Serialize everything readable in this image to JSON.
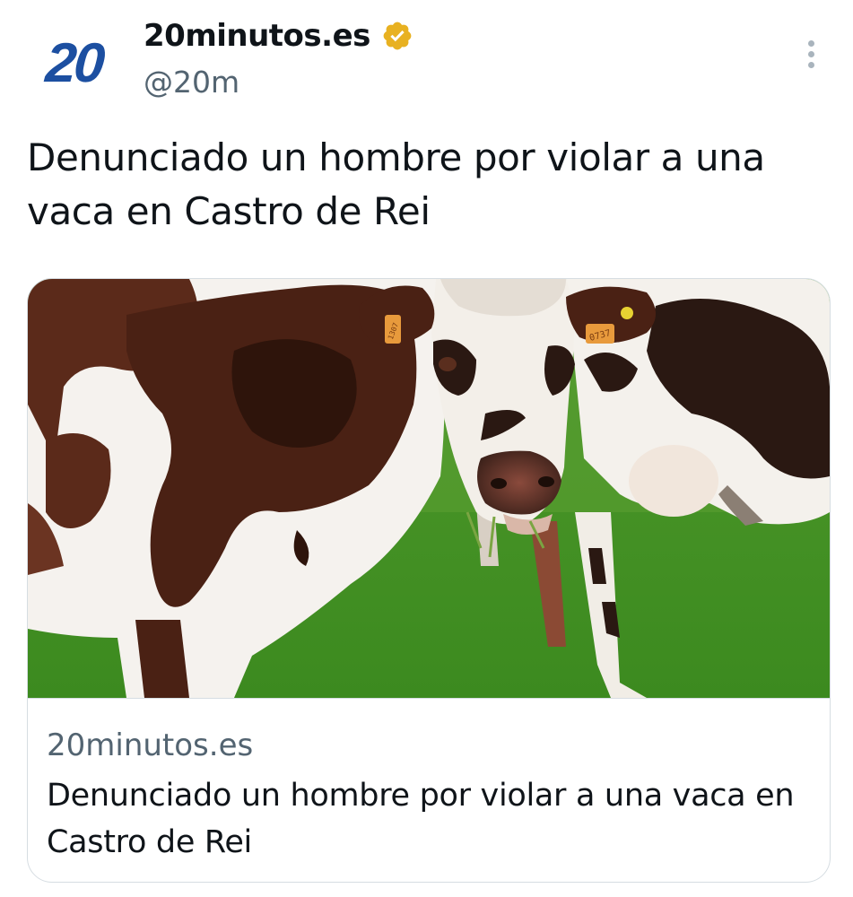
{
  "author": {
    "avatar_text": "20",
    "display_name": "20minutos.es",
    "handle": "@20m",
    "verified_badge_icon": "verified-gold-badge-icon",
    "brand_color": "#1c4fa1",
    "badge_color": "#e8b121"
  },
  "menu": {
    "icon": "more-options-icon"
  },
  "tweet": {
    "text": "Denunciado un hombre por violar a una vaca en Castro de Rei"
  },
  "link_card": {
    "image_icon": "cow-photo",
    "domain": "20minutos.es",
    "title": "Denunciado un hombre por violar a una vaca en Castro de Rei",
    "ear_tag_1": "0737",
    "ear_tag_2": "1307"
  }
}
